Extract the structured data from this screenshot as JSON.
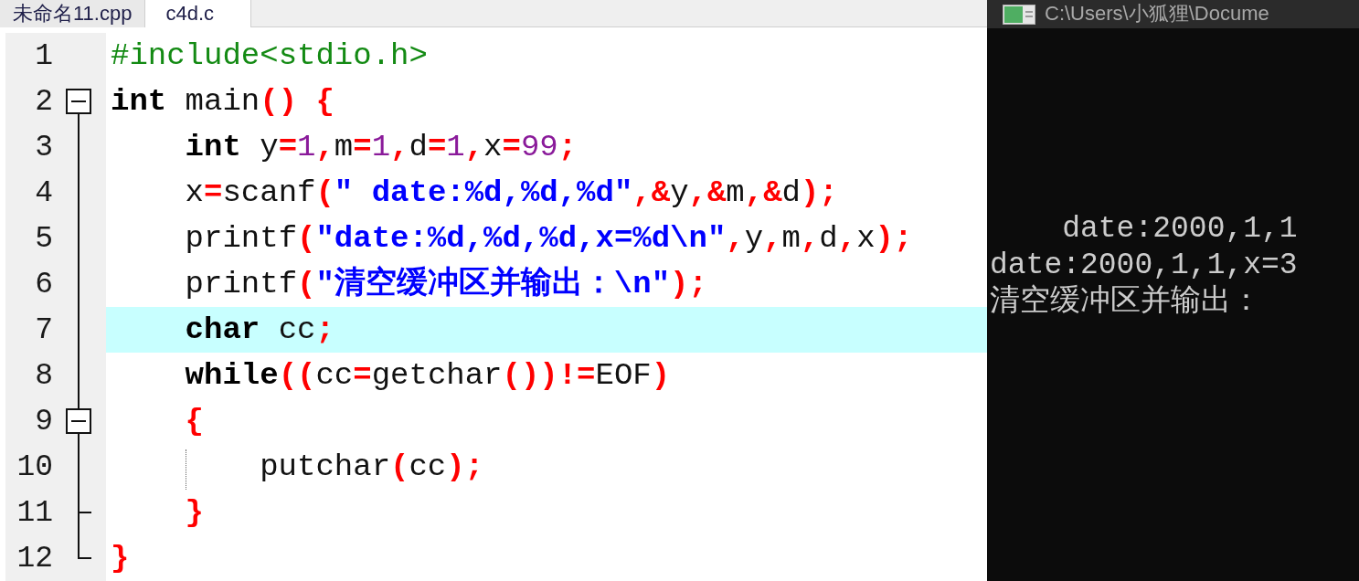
{
  "editor": {
    "tabs": [
      {
        "label": "未命名11.cpp",
        "selected": false
      },
      {
        "label": "c4d.c",
        "selected": true
      }
    ],
    "lines": [
      {
        "number": "1",
        "highlighted": false,
        "tokens": [
          {
            "kind": "preprocessor",
            "text": "#include<stdio.h>"
          }
        ]
      },
      {
        "number": "2",
        "highlighted": false,
        "expanded": true,
        "tokens": [
          {
            "kind": "keyword",
            "text": "int"
          },
          {
            "kind": "plain",
            "text": " main"
          },
          {
            "kind": "symbol",
            "text": "() {"
          }
        ],
        "children": [
          {
            "number": "3",
            "highlighted": false,
            "tokens": [
              {
                "kind": "keyword",
                "text": "int"
              },
              {
                "kind": "plain",
                "text": " y"
              },
              {
                "kind": "symbol",
                "text": "="
              },
              {
                "kind": "number",
                "text": "1"
              },
              {
                "kind": "symbol",
                "text": ","
              },
              {
                "kind": "plain",
                "text": "m"
              },
              {
                "kind": "symbol",
                "text": "="
              },
              {
                "kind": "number",
                "text": "1"
              },
              {
                "kind": "symbol",
                "text": ","
              },
              {
                "kind": "plain",
                "text": "d"
              },
              {
                "kind": "symbol",
                "text": "="
              },
              {
                "kind": "number",
                "text": "1"
              },
              {
                "kind": "symbol",
                "text": ","
              },
              {
                "kind": "plain",
                "text": "x"
              },
              {
                "kind": "symbol",
                "text": "="
              },
              {
                "kind": "number",
                "text": "99"
              },
              {
                "kind": "symbol",
                "text": ";"
              }
            ]
          },
          {
            "number": "4",
            "highlighted": false,
            "tokens": [
              {
                "kind": "plain",
                "text": "x"
              },
              {
                "kind": "symbol",
                "text": "="
              },
              {
                "kind": "plain",
                "text": "scanf"
              },
              {
                "kind": "symbol",
                "text": "("
              },
              {
                "kind": "string",
                "text": "\" date:%d,%d,%d\""
              },
              {
                "kind": "symbol",
                "text": ",&"
              },
              {
                "kind": "plain",
                "text": "y"
              },
              {
                "kind": "symbol",
                "text": ",&"
              },
              {
                "kind": "plain",
                "text": "m"
              },
              {
                "kind": "symbol",
                "text": ",&"
              },
              {
                "kind": "plain",
                "text": "d"
              },
              {
                "kind": "symbol",
                "text": ");"
              }
            ]
          },
          {
            "number": "5",
            "highlighted": false,
            "tokens": [
              {
                "kind": "plain",
                "text": "printf"
              },
              {
                "kind": "symbol",
                "text": "("
              },
              {
                "kind": "string",
                "text": "\"date:%d,%d,%d,x=%d\\n\""
              },
              {
                "kind": "symbol",
                "text": ","
              },
              {
                "kind": "plain",
                "text": "y"
              },
              {
                "kind": "symbol",
                "text": ","
              },
              {
                "kind": "plain",
                "text": "m"
              },
              {
                "kind": "symbol",
                "text": ","
              },
              {
                "kind": "plain",
                "text": "d"
              },
              {
                "kind": "symbol",
                "text": ","
              },
              {
                "kind": "plain",
                "text": "x"
              },
              {
                "kind": "symbol",
                "text": ");"
              }
            ]
          },
          {
            "number": "6",
            "highlighted": false,
            "tokens": [
              {
                "kind": "plain",
                "text": "printf"
              },
              {
                "kind": "symbol",
                "text": "("
              },
              {
                "kind": "string",
                "text": "\"清空缓冲区并输出：\\n\""
              },
              {
                "kind": "symbol",
                "text": ");"
              }
            ]
          },
          {
            "number": "7",
            "highlighted": true,
            "tokens": [
              {
                "kind": "keyword",
                "text": "char"
              },
              {
                "kind": "plain",
                "text": " cc"
              },
              {
                "kind": "symbol",
                "text": ";"
              }
            ]
          },
          {
            "number": "8",
            "highlighted": false,
            "tokens": [
              {
                "kind": "keyword",
                "text": "while"
              },
              {
                "kind": "symbol",
                "text": "(("
              },
              {
                "kind": "plain",
                "text": "cc"
              },
              {
                "kind": "symbol",
                "text": "="
              },
              {
                "kind": "plain",
                "text": "getchar"
              },
              {
                "kind": "symbol",
                "text": "())!="
              },
              {
                "kind": "plain",
                "text": "EOF"
              },
              {
                "kind": "symbol",
                "text": ")"
              }
            ]
          },
          {
            "number": "9",
            "highlighted": false,
            "expanded": true,
            "tokens": [
              {
                "kind": "symbol",
                "text": "{"
              }
            ],
            "children": [
              {
                "number": "10",
                "highlighted": false,
                "tokens": [
                  {
                    "kind": "plain",
                    "text": "putchar"
                  },
                  {
                    "kind": "symbol",
                    "text": "("
                  },
                  {
                    "kind": "plain",
                    "text": "cc"
                  },
                  {
                    "kind": "symbol",
                    "text": ");"
                  }
                ]
              }
            ]
          },
          {
            "number": "11",
            "highlighted": false,
            "tokens": [
              {
                "kind": "symbol",
                "text": "}"
              }
            ]
          }
        ]
      },
      {
        "number": "12",
        "highlighted": false,
        "tokens": [
          {
            "kind": "symbol",
            "text": "}"
          }
        ]
      }
    ]
  },
  "console": {
    "title": "C:\\Users\\小狐狸\\Docume",
    "output": [
      "    date:2000,1,1",
      "date:2000,1,1,x=3",
      "清空缓冲区并输出："
    ]
  }
}
